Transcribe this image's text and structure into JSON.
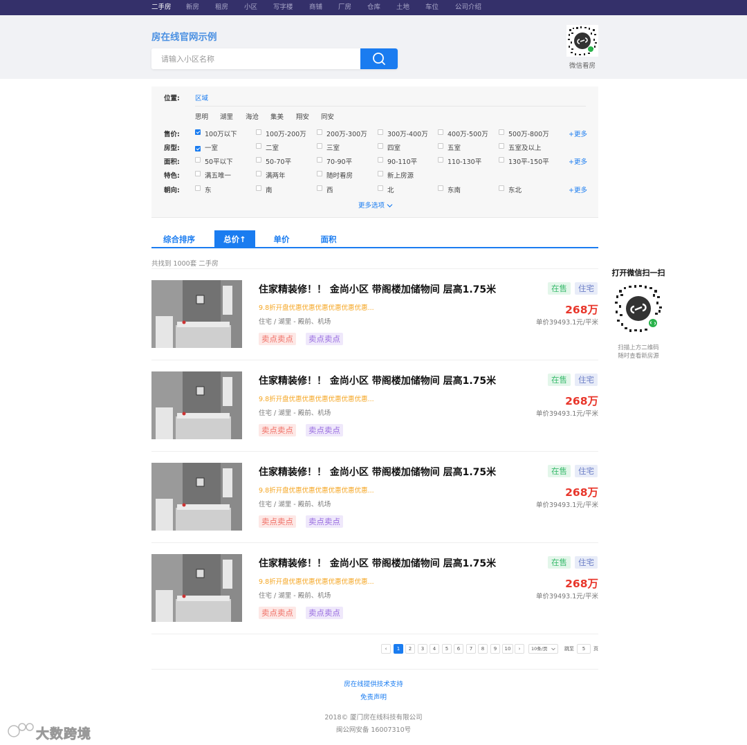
{
  "nav": {
    "items": [
      "二手房",
      "新房",
      "租房",
      "小区",
      "写字楼",
      "商铺",
      "厂房",
      "仓库",
      "土地",
      "车位",
      "公司介绍"
    ],
    "active": "二手房"
  },
  "header": {
    "site_title": "房在线官网示例",
    "search_placeholder": "请输入小区名称",
    "qr_label": "微信看房"
  },
  "filters": {
    "location": {
      "label": "位置:",
      "mode": "区域",
      "districts": [
        "思明",
        "湖里",
        "海沧",
        "集美",
        "翔安",
        "同安"
      ]
    },
    "price": {
      "label": "售价:",
      "options": [
        "100万以下",
        "100万-200万",
        "200万-300万",
        "300万-400万",
        "400万-500万",
        "500万-800万"
      ],
      "more": "+更多"
    },
    "layout": {
      "label": "房型:",
      "options": [
        "一室",
        "二室",
        "三室",
        "四室",
        "五室",
        "五室及以上"
      ]
    },
    "area": {
      "label": "面积:",
      "options": [
        "50平以下",
        "50-70平",
        "70-90平",
        "90-110平",
        "110-130平",
        "130平-150平"
      ],
      "more": "+更多"
    },
    "feature": {
      "label": "特色:",
      "options": [
        "满五唯一",
        "满两年",
        "随时看房",
        "新上房源"
      ]
    },
    "orientation": {
      "label": "朝向:",
      "options": [
        "东",
        "南",
        "西",
        "北",
        "东南",
        "东北"
      ],
      "more": "+更多"
    },
    "more_options": "更多选项"
  },
  "sort": {
    "tabs": [
      "综合排序",
      "总价↑",
      "单价",
      "面积"
    ],
    "active": "总价↑"
  },
  "result_count": "共找到 1000套 二手房",
  "listings": [
    {
      "title": "住家精装修！！ 金尚小区 带阁楼加储物间 层高1.75米",
      "promo": "9.8折开盘优惠优惠优惠优惠优惠优惠...",
      "meta": "住宅 / 湖里 - 殿前、机场",
      "tags": [
        "卖点卖点",
        "卖点卖点"
      ],
      "status": "在售",
      "type": "住宅",
      "price": "268万",
      "unit_price": "单价39493.1元/平米"
    },
    {
      "title": "住家精装修！！ 金尚小区 带阁楼加储物间 层高1.75米",
      "promo": "9.8折开盘优惠优惠优惠优惠优惠优惠...",
      "meta": "住宅 / 湖里 - 殿前、机场",
      "tags": [
        "卖点卖点",
        "卖点卖点"
      ],
      "status": "在售",
      "type": "住宅",
      "price": "268万",
      "unit_price": "单价39493.1元/平米"
    },
    {
      "title": "住家精装修！！ 金尚小区 带阁楼加储物间 层高1.75米",
      "promo": "9.8折开盘优惠优惠优惠优惠优惠优惠...",
      "meta": "住宅 / 湖里 - 殿前、机场",
      "tags": [
        "卖点卖点",
        "卖点卖点"
      ],
      "status": "在售",
      "type": "住宅",
      "price": "268万",
      "unit_price": "单价39493.1元/平米"
    },
    {
      "title": "住家精装修！！ 金尚小区 带阁楼加储物间 层高1.75米",
      "promo": "9.8折开盘优惠优惠优惠优惠优惠优惠...",
      "meta": "住宅 / 湖里 - 殿前、机场",
      "tags": [
        "卖点卖点",
        "卖点卖点"
      ],
      "status": "在售",
      "type": "住宅",
      "price": "268万",
      "unit_price": "单价39493.1元/平米"
    }
  ],
  "pagination": {
    "prev": "‹",
    "pages": [
      "1",
      "2",
      "3",
      "4",
      "5",
      "6",
      "7",
      "8",
      "9",
      "10"
    ],
    "active": "1",
    "next": "›",
    "page_size": "10条/页",
    "jump_label": "跳至",
    "jump_value": "5",
    "jump_unit": "页"
  },
  "side": {
    "title": "打开微信扫一扫",
    "note_line1": "扫描上方二维码",
    "note_line2": "随时查看新房源"
  },
  "footer": {
    "support": "房在线提供技术支持",
    "disclaimer": "免责声明",
    "copyright": "2018© 厦门房在线科技有限公司",
    "icp": "闽公网安备 16007310号"
  },
  "watermark": "大数跨境",
  "colors": {
    "nav_bg": "#34306a",
    "accent": "#1a7cf0",
    "price": "#e8362b",
    "promo": "#f5a623",
    "status_sale": "#3bbb6e",
    "status_type": "#6d7fc7"
  }
}
